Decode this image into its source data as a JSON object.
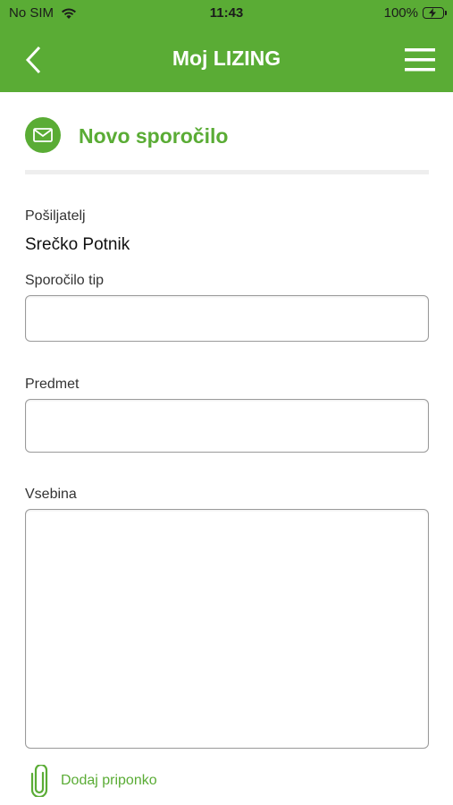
{
  "status_bar": {
    "carrier": "No SIM",
    "time": "11:43",
    "battery": "100%"
  },
  "nav": {
    "title": "Moj LIZING",
    "back_icon": "chevron-left-icon",
    "menu_icon": "hamburger-menu-icon"
  },
  "header": {
    "title": "Novo sporočilo",
    "icon": "envelope-icon"
  },
  "form": {
    "sender_label": "Pošiljatelj",
    "sender_value": "Srečko Potnik",
    "type_label": "Sporočilo tip",
    "type_value": "",
    "subject_label": "Predmet",
    "subject_value": "",
    "content_label": "Vsebina",
    "content_value": ""
  },
  "attachment": {
    "label": "Dodaj priponko",
    "icon": "paperclip-icon"
  },
  "colors": {
    "brand": "#5aac35",
    "divider": "#eeeeee",
    "field_border": "#9a9a9a"
  }
}
